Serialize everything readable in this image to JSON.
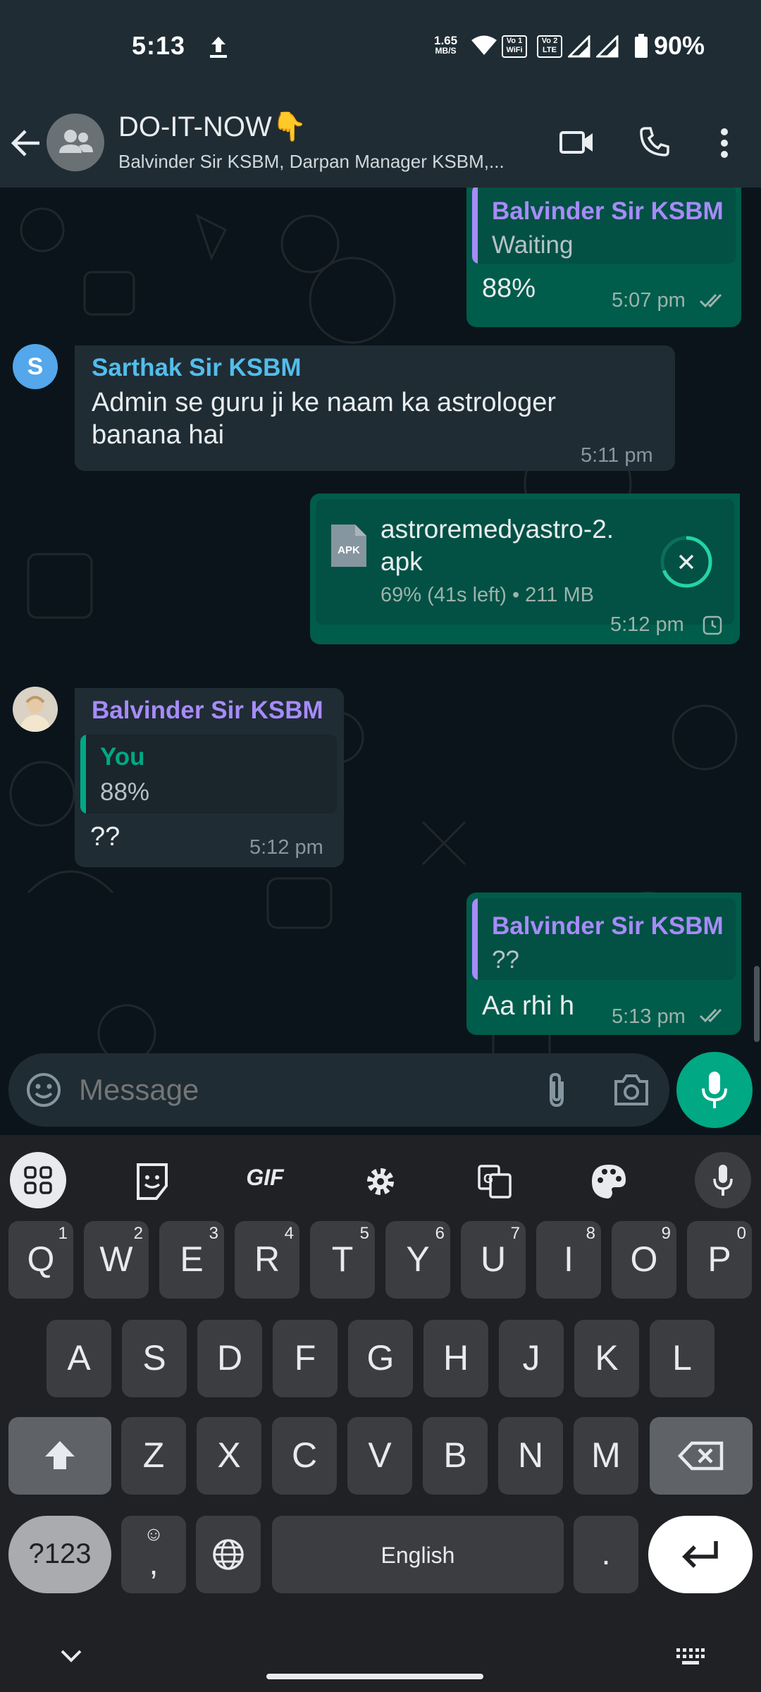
{
  "status_bar": {
    "time": "5:13",
    "net_speed_value": "1.65",
    "net_speed_unit": "MB/S",
    "sim1_label": "Vo 1 WiFi",
    "sim2_label": "Vo 2 LTE",
    "battery": "90%"
  },
  "header": {
    "title": "DO-IT-NOW👇",
    "subtitle": "Balvinder Sir KSBM, Darpan Manager KSBM,..."
  },
  "messages": {
    "m1": {
      "quote_name": "Balvinder Sir KSBM",
      "quote_text": "Waiting",
      "text": "88%",
      "time": "5:07 pm"
    },
    "m2": {
      "avatar_letter": "S",
      "sender": "Sarthak Sir KSBM",
      "line1": "Admin se guru ji ke naam ka astrologer",
      "line2": "banana hai",
      "time": "5:11 pm"
    },
    "m3": {
      "file_ext": "APK",
      "file_name_line1": "astroremedyastro-2.",
      "file_name_line2": "apk",
      "file_meta": "69% (41s left) • 211 MB",
      "progress": 0.69,
      "time": "5:12 pm"
    },
    "m4": {
      "sender": "Balvinder Sir KSBM",
      "quote_name": "You",
      "quote_text": "88%",
      "text": "??",
      "time": "5:12 pm"
    },
    "m5": {
      "quote_name": "Balvinder Sir KSBM",
      "quote_text": "??",
      "text": "Aa rhi h",
      "time": "5:13 pm"
    }
  },
  "input": {
    "placeholder": "Message"
  },
  "keyboard": {
    "toolbar": {
      "gif": "GIF"
    },
    "row1": [
      {
        "k": "Q",
        "h": "1"
      },
      {
        "k": "W",
        "h": "2"
      },
      {
        "k": "E",
        "h": "3"
      },
      {
        "k": "R",
        "h": "4"
      },
      {
        "k": "T",
        "h": "5"
      },
      {
        "k": "Y",
        "h": "6"
      },
      {
        "k": "U",
        "h": "7"
      },
      {
        "k": "I",
        "h": "8"
      },
      {
        "k": "O",
        "h": "9"
      },
      {
        "k": "P",
        "h": "0"
      }
    ],
    "row2": [
      "A",
      "S",
      "D",
      "F",
      "G",
      "H",
      "J",
      "K",
      "L"
    ],
    "row3": [
      "Z",
      "X",
      "C",
      "V",
      "B",
      "N",
      "M"
    ],
    "symbols_key": "?123",
    "comma_key": ",",
    "space_key": "English",
    "period_key": "."
  },
  "colors": {
    "header_bg": "#1f2c34",
    "chat_bg": "#0b141a",
    "outgoing_bubble": "#005c4b",
    "incoming_bubble": "#1f2c34",
    "accent_green": "#00a884",
    "sender_purple": "#a78bfa",
    "sender_blue": "#53bdeb"
  },
  "icons": [
    "back-arrow-icon",
    "group-avatar-icon",
    "video-call-icon",
    "phone-icon",
    "more-options-icon",
    "double-check-icon",
    "clock-pending-icon",
    "cancel-download-icon",
    "emoji-icon",
    "attach-icon",
    "camera-icon",
    "mic-icon"
  ]
}
